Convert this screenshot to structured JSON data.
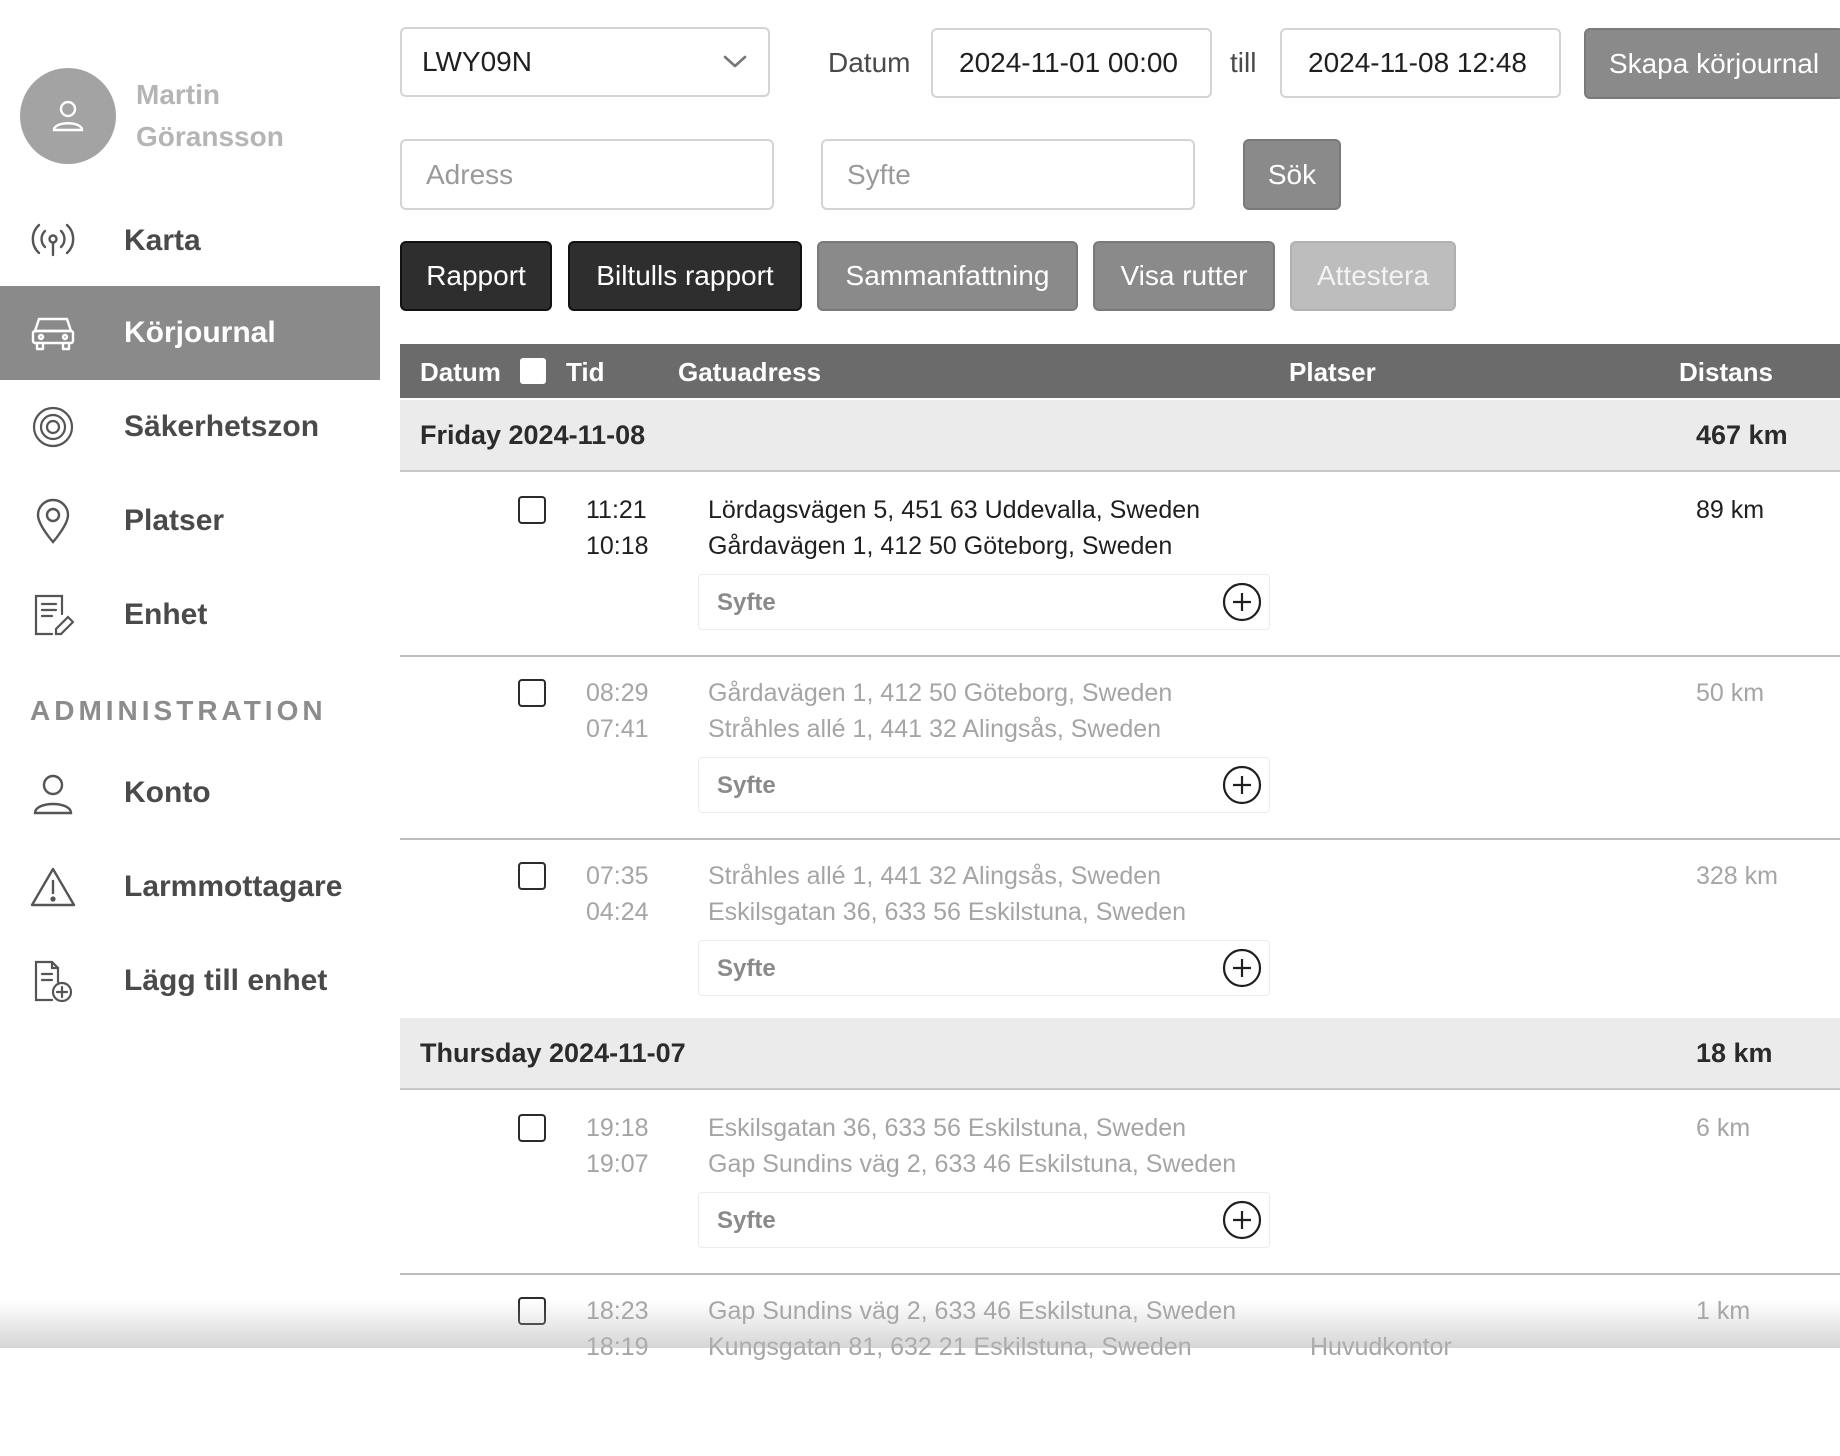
{
  "user": {
    "name": "Martin Göransson"
  },
  "nav": {
    "items": [
      {
        "label": "Karta",
        "icon": "antenna-icon"
      },
      {
        "label": "Körjournal",
        "icon": "car-icon",
        "active": true
      },
      {
        "label": "Säkerhetszon",
        "icon": "target-icon"
      },
      {
        "label": "Platser",
        "icon": "location-pin-icon"
      },
      {
        "label": "Enhet",
        "icon": "edit-document-icon"
      }
    ],
    "admin_heading": "ADMINISTRATION",
    "admin_items": [
      {
        "label": "Konto",
        "icon": "user-icon"
      },
      {
        "label": "Larmmottagare",
        "icon": "warning-icon"
      },
      {
        "label": "Lägg till enhet",
        "icon": "add-document-icon"
      }
    ]
  },
  "filters": {
    "vehicle": "LWY09N",
    "date_label": "Datum",
    "date_from": "2024-11-01 00:00",
    "till_label": "till",
    "date_to": "2024-11-08 12:48",
    "create_button": "Skapa körjournal",
    "address_placeholder": "Adress",
    "purpose_placeholder": "Syfte",
    "search_button": "Sök"
  },
  "actions": {
    "rapport": "Rapport",
    "biltulls": "Biltulls rapport",
    "sammanfattning": "Sammanfattning",
    "visa_rutter": "Visa rutter",
    "attestera": "Attestera"
  },
  "table": {
    "headers": {
      "datum": "Datum",
      "tid": "Tid",
      "gatuadress": "Gatuadress",
      "platser": "Platser",
      "distans": "Distans"
    },
    "syfte_label": "Syfte",
    "days": [
      {
        "label": "Friday 2024-11-08",
        "distance": "467 km",
        "trips": [
          {
            "time_end": "11:21",
            "time_start": "10:18",
            "addr_to": "Lördagsvägen 5, 451 63 Uddevalla, Sweden",
            "addr_from": "Gårdavägen 1, 412 50 Göteborg, Sweden",
            "place": "",
            "distance": "89 km"
          },
          {
            "time_end": "08:29",
            "time_start": "07:41",
            "addr_to": "Gårdavägen 1, 412 50 Göteborg, Sweden",
            "addr_from": "Stråhles allé 1, 441 32 Alingsås, Sweden",
            "place": "",
            "distance": "50 km"
          },
          {
            "time_end": "07:35",
            "time_start": "04:24",
            "addr_to": "Stråhles allé 1, 441 32 Alingsås, Sweden",
            "addr_from": "Eskilsgatan 36, 633 56 Eskilstuna, Sweden",
            "place": "",
            "distance": "328 km"
          }
        ]
      },
      {
        "label": "Thursday 2024-11-07",
        "distance": "18 km",
        "trips": [
          {
            "time_end": "19:18",
            "time_start": "19:07",
            "addr_to": "Eskilsgatan 36, 633 56 Eskilstuna, Sweden",
            "addr_from": "Gap Sundins väg 2, 633 46 Eskilstuna, Sweden",
            "place": "",
            "distance": "6 km"
          },
          {
            "time_end": "18:23",
            "time_start": "18:19",
            "addr_to": "Gap Sundins väg 2, 633 46 Eskilstuna, Sweden",
            "addr_from": "Kungsgatan 81, 632 21 Eskilstuna, Sweden",
            "place": "Huvudkontor",
            "distance": "1 km"
          }
        ]
      }
    ]
  }
}
